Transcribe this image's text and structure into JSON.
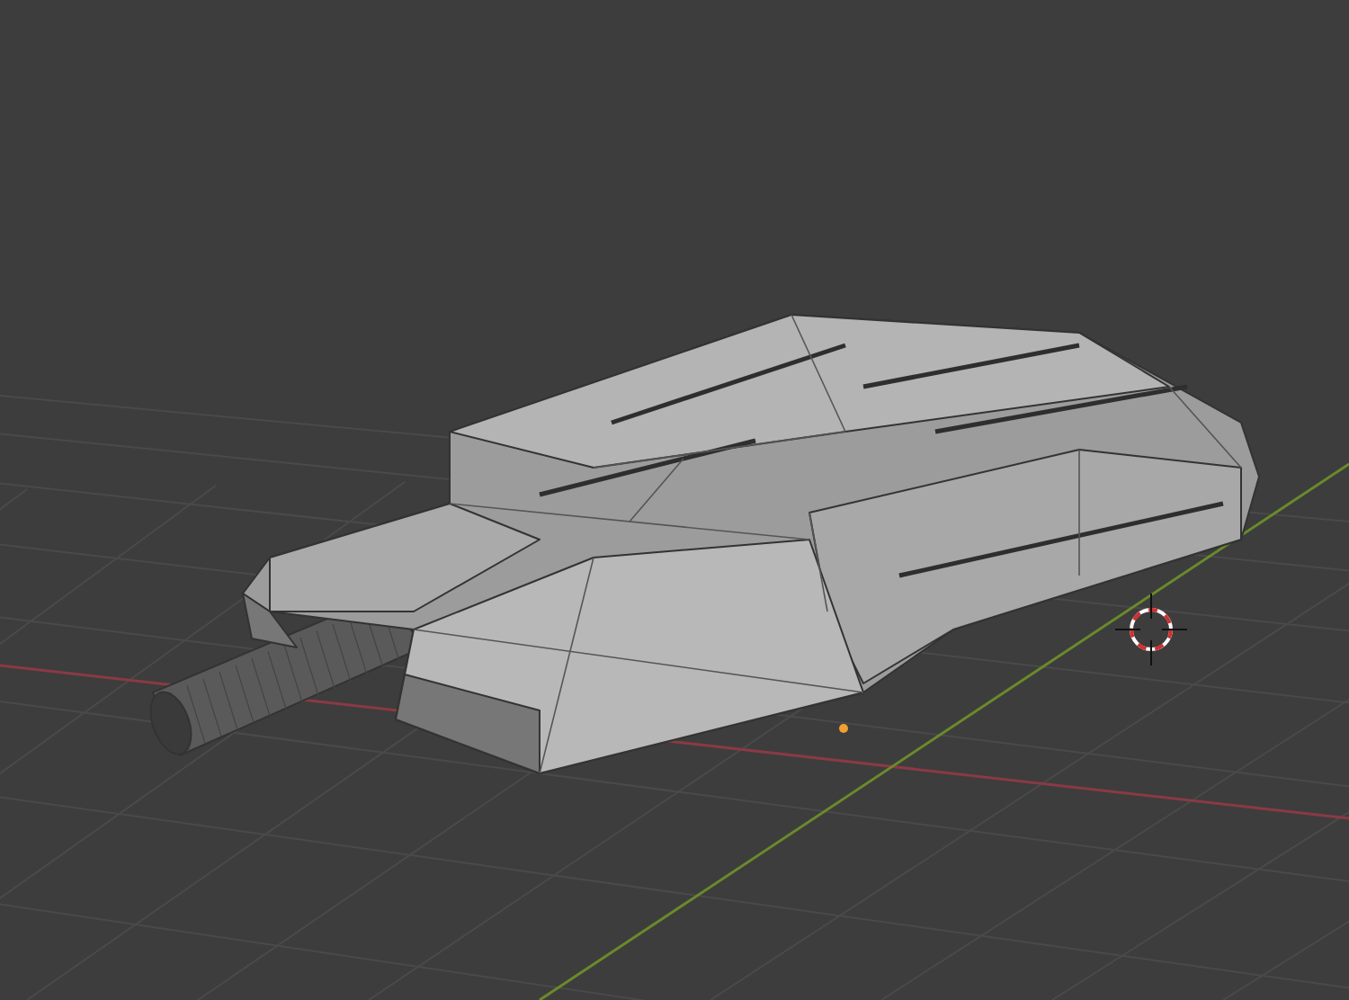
{
  "viewport": {
    "grid_floor": true,
    "x_axis": true,
    "y_axis": true,
    "cursor_3d": true,
    "origin_point": true
  }
}
